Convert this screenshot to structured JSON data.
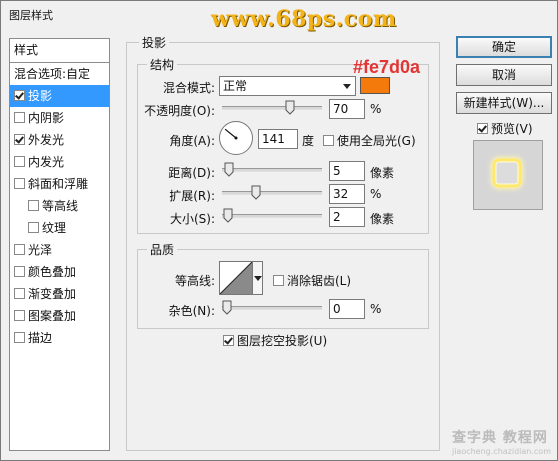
{
  "window": {
    "title": "图层样式",
    "watermark": "www.68ps.com"
  },
  "sidebar": {
    "header": "样式",
    "blend_options": "混合选项:自定",
    "items": [
      {
        "label": "投影",
        "checked": true,
        "selected": true,
        "indent": false
      },
      {
        "label": "内阴影",
        "checked": false,
        "selected": false,
        "indent": false
      },
      {
        "label": "外发光",
        "checked": true,
        "selected": false,
        "indent": false
      },
      {
        "label": "内发光",
        "checked": false,
        "selected": false,
        "indent": false
      },
      {
        "label": "斜面和浮雕",
        "checked": false,
        "selected": false,
        "indent": false
      },
      {
        "label": "等高线",
        "checked": false,
        "selected": false,
        "indent": true
      },
      {
        "label": "纹理",
        "checked": false,
        "selected": false,
        "indent": true
      },
      {
        "label": "光泽",
        "checked": false,
        "selected": false,
        "indent": false
      },
      {
        "label": "颜色叠加",
        "checked": false,
        "selected": false,
        "indent": false
      },
      {
        "label": "渐变叠加",
        "checked": false,
        "selected": false,
        "indent": false
      },
      {
        "label": "图案叠加",
        "checked": false,
        "selected": false,
        "indent": false
      },
      {
        "label": "描边",
        "checked": false,
        "selected": false,
        "indent": false
      }
    ]
  },
  "panel": {
    "title": "投影",
    "structure": {
      "title": "结构",
      "color_annotation": "#fe7d0a",
      "shadow_color": "#f47a0c",
      "blend_mode_label": "混合模式:",
      "blend_mode_value": "正常",
      "opacity_label": "不透明度(O):",
      "opacity_value": "70",
      "opacity_unit": "%",
      "opacity_level": 0.7,
      "angle_label": "角度(A):",
      "angle_value": "141",
      "angle_unit": "度",
      "global_light_label": "使用全局光(G)",
      "global_light_checked": false,
      "distance_label": "距离(D):",
      "distance_value": "5",
      "distance_unit": "像素",
      "distance_level": 0.02,
      "spread_label": "扩展(R):",
      "spread_value": "32",
      "spread_unit": "%",
      "spread_level": 0.32,
      "size_label": "大小(S):",
      "size_value": "2",
      "size_unit": "像素",
      "size_level": 0.01
    },
    "quality": {
      "title": "品质",
      "contour_label": "等高线:",
      "antialias_label": "消除锯齿(L)",
      "antialias_checked": false,
      "noise_label": "杂色(N):",
      "noise_value": "0",
      "noise_unit": "%",
      "noise_level": 0.0
    },
    "knockout_label": "图层挖空投影(U)",
    "knockout_checked": true
  },
  "buttons": {
    "ok": "确定",
    "cancel": "取消",
    "new_style": "新建样式(W)...",
    "preview_label": "预览(V)",
    "preview_checked": true
  },
  "site_watermark": {
    "main": "查字典 教程网",
    "sub": "jiaocheng.chazidian.com"
  }
}
